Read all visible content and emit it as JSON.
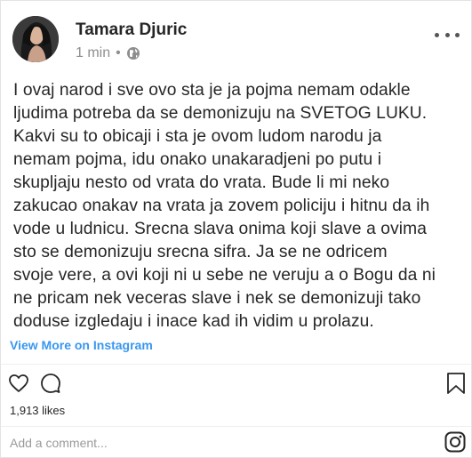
{
  "post": {
    "author_name": "Tamara Djuric",
    "time_ago": "1 min",
    "separator": "•",
    "visibility_icon": "globe-icon",
    "more_icon": "more-options-icon",
    "text": "I ovaj narod i sve ovo sta je ja pojma nemam odakle\nljudima potreba da se demonizuju na SVETOG LUKU.\nKakvi su to obicaji i sta je ovom ludom narodu ja\nnemam pojma, idu onako unakaradjeni po putu i\nskupljaju nesto od vrata do vrata. Bude li mi neko\nzakucao onakav na vrata ja zovem policiju i hitnu da ih\nvode u ludnicu. Srecna slava onima koji slave a ovima\nsto se demonizuju srecna sifra. Ja se ne odricem\nsvoje vere, a ovi koji ni u sebe ne veruju a o Bogu da ni\nne pricam nek veceras slave i nek se demonizuji tako\ndoduse izgledaju i inace kad ih vidim u prolazu.",
    "view_more_label": "View More on Instagram"
  },
  "actions": {
    "like_icon": "heart-icon",
    "comment_icon": "comment-icon",
    "save_icon": "bookmark-icon"
  },
  "likes": "1,913 likes",
  "comment": {
    "placeholder": "Add a comment...",
    "instagram_icon": "instagram-icon"
  },
  "colors": {
    "link": "#3897f0",
    "text": "#262626",
    "muted": "#8e8e8e"
  }
}
